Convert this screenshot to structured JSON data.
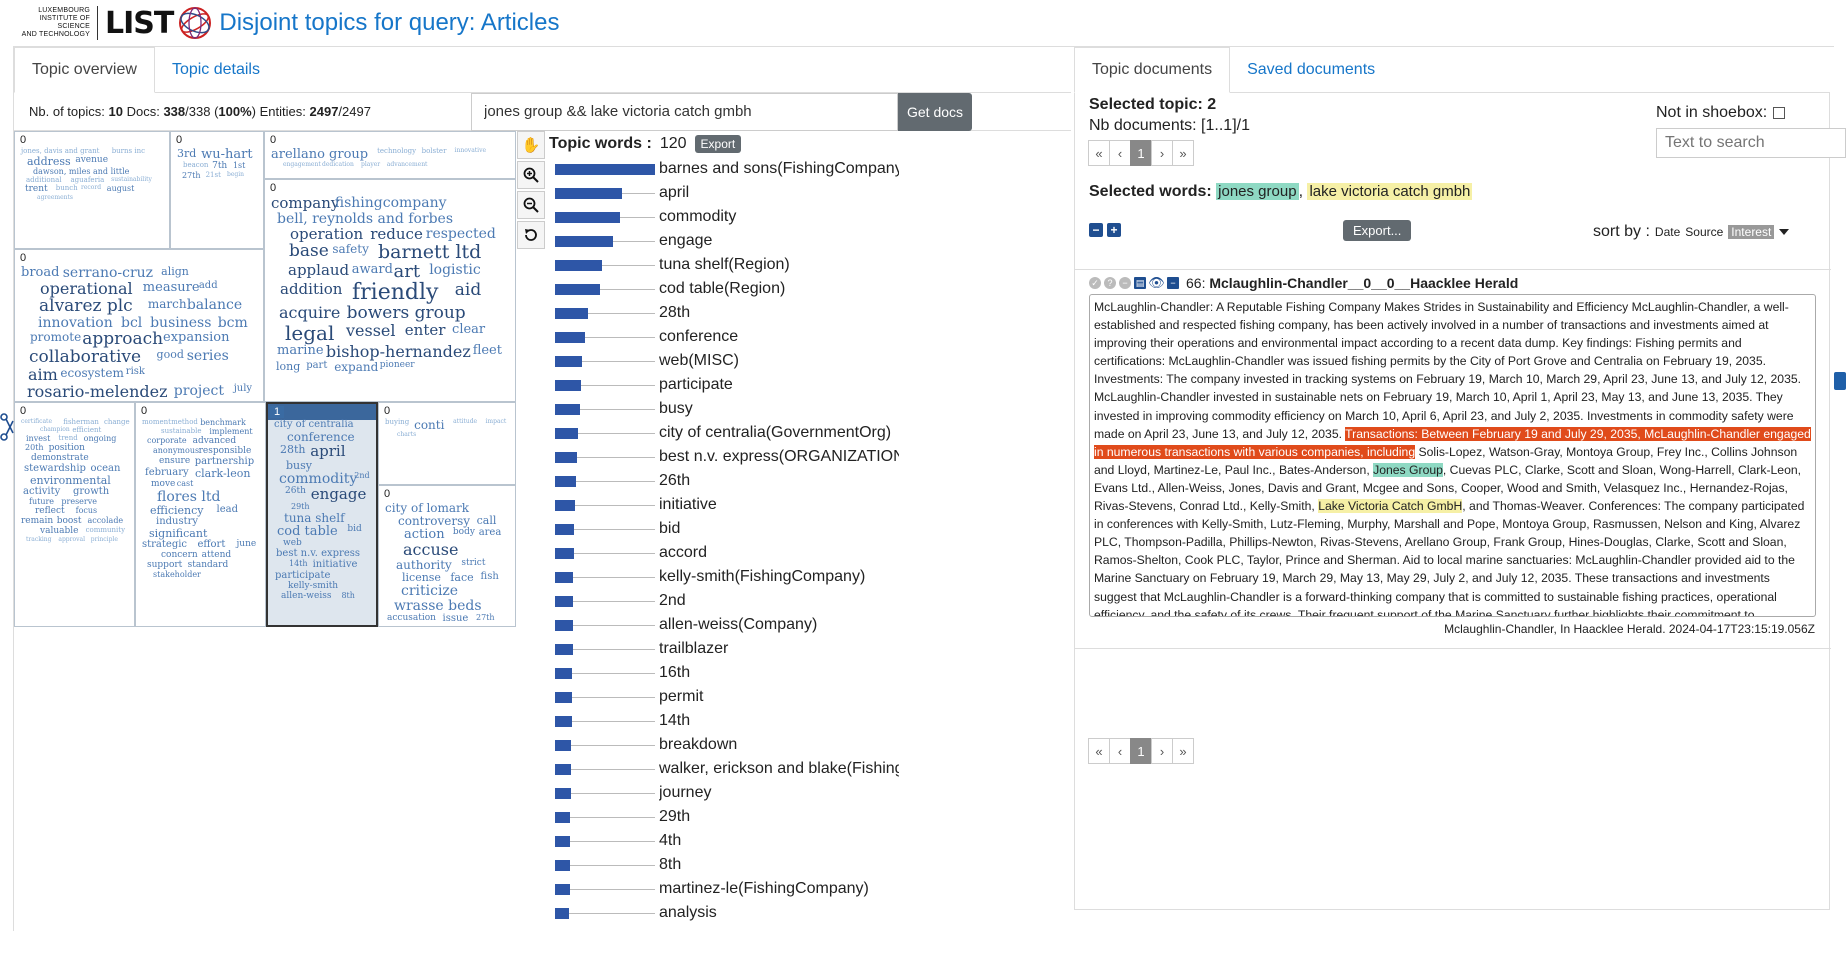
{
  "header": {
    "logo_lines": [
      "LUXEMBOURG",
      "INSTITUTE OF SCIENCE",
      "AND TECHNOLOGY"
    ],
    "logo_brand": "LIST",
    "title": "Disjoint topics for query: Articles"
  },
  "left_tabs": [
    {
      "label": "Topic overview",
      "active": true
    },
    {
      "label": "Topic details",
      "active": false
    }
  ],
  "right_tabs": [
    {
      "label": "Topic documents",
      "active": true
    },
    {
      "label": "Saved documents",
      "active": false
    }
  ],
  "info": {
    "topics_label": "Nb. of topics:",
    "topics": "10",
    "docs_label": "Docs:",
    "docs": "338",
    "docs_total": "/338 (",
    "docs_pct": "100%",
    "docs_close": ")",
    "entities_label": "Entities:",
    "entities": "2497",
    "entities_total": "/2497"
  },
  "query": {
    "value": "jones group && lake victoria catch gmbh",
    "button": "Get docs"
  },
  "topic_cells": [
    {
      "num": "0",
      "words": [
        "jones, davis and grant",
        "burns inc",
        "address",
        "avenue",
        "dawson, miles and little",
        "additional",
        "aguaferia",
        "sustainability",
        "trent",
        "bunch",
        "record",
        "august",
        "agreements"
      ]
    },
    {
      "num": "0",
      "words": [
        "3rd",
        "wu-hart",
        "beacon",
        "7th",
        "1st",
        "27th",
        "21st",
        "begin"
      ]
    },
    {
      "num": "0",
      "words": [
        "arellano group",
        "technology",
        "bolster",
        "innovative",
        "engagement",
        "dedication",
        "player",
        "advancement"
      ]
    },
    {
      "num": "0",
      "words": [
        "company",
        "fishingcompany",
        "bell, reynolds and forbes",
        "operation",
        "reduce",
        "respected",
        "base",
        "safety",
        "barnett ltd",
        "applaud",
        "award",
        "art",
        "logistic",
        "addition",
        "friendly",
        "aid",
        "acquire",
        "bowers group",
        "legal",
        "vessel",
        "enter",
        "clear",
        "marine",
        "bishop-hernandez",
        "fleet",
        "long",
        "part",
        "expand",
        "pioneer"
      ]
    },
    {
      "num": "0",
      "words": [
        "broad",
        "serrano-cruz",
        "align",
        "operational",
        "measure",
        "add",
        "alvarez plc",
        "march",
        "balance",
        "innovation",
        "bcl",
        "business",
        "bcm",
        "promote",
        "approach",
        "expansion",
        "collaborative",
        "good",
        "series",
        "aim",
        "ecosystem",
        "risk",
        "rosario-melendez",
        "project",
        "july",
        "success",
        "multiple"
      ]
    },
    {
      "num": "0",
      "words": [
        "certificate",
        "fisherman",
        "change",
        "champion",
        "efficient",
        "invest",
        "trend",
        "ongoing",
        "20th",
        "position",
        "demonstrate",
        "stewardship",
        "ocean",
        "environmental",
        "activity",
        "growth",
        "future",
        "preserve",
        "reflect",
        "focus",
        "remain",
        "boost",
        "accolade",
        "valuable",
        "community",
        "tracking",
        "approval",
        "principle"
      ]
    },
    {
      "num": "0",
      "words": [
        "moment",
        "method",
        "benchmark",
        "sustainable",
        "implement",
        "corporate",
        "advanced",
        "anonymous",
        "responsible",
        "ensure",
        "partnership",
        "february",
        "clark-leon",
        "move",
        "cast",
        "flores ltd",
        "efficiency",
        "lead",
        "industry",
        "significant",
        "strategic",
        "effort",
        "june",
        "concern",
        "attend",
        "support",
        "standard",
        "stakeholder"
      ]
    },
    {
      "num": "1",
      "selected": true,
      "words": [
        "city of centralia",
        "conference",
        "28th",
        "april",
        "busy",
        "commodity",
        "2nd",
        "26th",
        "engage",
        "29th",
        "tuna shelf",
        "cod table",
        "bid",
        "web",
        "best n.v. express",
        "14th",
        "initiative",
        "participate",
        "kelly-smith",
        "allen-weiss",
        "8th"
      ]
    },
    {
      "num": "0",
      "words": [
        "buying",
        "conti",
        "attitude",
        "impact",
        "charts"
      ]
    },
    {
      "num": "0",
      "words": [
        "city of lomark",
        "controversy",
        "call",
        "action",
        "body",
        "area",
        "accuse",
        "authority",
        "strict",
        "license",
        "face",
        "fish",
        "criticize",
        "wrasse beds",
        "accusation",
        "issue",
        "27th"
      ]
    }
  ],
  "map_tools": [
    {
      "name": "hand-icon",
      "glyph": "✋"
    },
    {
      "name": "zoom-in-icon",
      "glyph": "⊕"
    },
    {
      "name": "zoom-out-icon",
      "glyph": "⊖"
    },
    {
      "name": "reset-icon",
      "glyph": "↺"
    }
  ],
  "topic_words": {
    "title": "Topic words :",
    "count": "120",
    "export": "Export",
    "items": [
      {
        "label": "barnes and sons(FishingCompany)",
        "weight": 1.0
      },
      {
        "label": "april",
        "weight": 0.67
      },
      {
        "label": "commodity",
        "weight": 0.65
      },
      {
        "label": "engage",
        "weight": 0.58
      },
      {
        "label": "tuna shelf(Region)",
        "weight": 0.47
      },
      {
        "label": "cod table(Region)",
        "weight": 0.45
      },
      {
        "label": "28th",
        "weight": 0.33
      },
      {
        "label": "conference",
        "weight": 0.3
      },
      {
        "label": "web(MISC)",
        "weight": 0.27
      },
      {
        "label": "participate",
        "weight": 0.26
      },
      {
        "label": "busy",
        "weight": 0.25
      },
      {
        "label": "city of centralia(GovernmentOrg)",
        "weight": 0.23
      },
      {
        "label": "best n.v. express(ORGANIZATION)",
        "weight": 0.22
      },
      {
        "label": "26th",
        "weight": 0.21
      },
      {
        "label": "initiative",
        "weight": 0.2
      },
      {
        "label": "bid",
        "weight": 0.19
      },
      {
        "label": "accord",
        "weight": 0.19
      },
      {
        "label": "kelly-smith(FishingCompany)",
        "weight": 0.18
      },
      {
        "label": "2nd",
        "weight": 0.18
      },
      {
        "label": "allen-weiss(Company)",
        "weight": 0.18
      },
      {
        "label": "trailblazer",
        "weight": 0.18
      },
      {
        "label": "16th",
        "weight": 0.17
      },
      {
        "label": "permit",
        "weight": 0.17
      },
      {
        "label": "14th",
        "weight": 0.17
      },
      {
        "label": "breakdown",
        "weight": 0.16
      },
      {
        "label": "walker, erickson and blake(FishingCompany)",
        "weight": 0.16
      },
      {
        "label": "journey",
        "weight": 0.16
      },
      {
        "label": "29th",
        "weight": 0.15
      },
      {
        "label": "4th",
        "weight": 0.15
      },
      {
        "label": "8th",
        "weight": 0.15
      },
      {
        "label": "martinez-le(FishingCompany)",
        "weight": 0.15
      },
      {
        "label": "analysis",
        "weight": 0.14
      }
    ]
  },
  "right": {
    "selected_topic": "Selected topic: 2",
    "nb_docs": "Nb documents: [1..1]/1",
    "pager": [
      "«",
      "‹",
      "1",
      "›",
      "»"
    ],
    "shoebox_label": "Not in shoebox:",
    "search_placeholder": "Text to search",
    "selected_words_label": "Selected words:",
    "selected_word_1": "jones group",
    "selected_word_sep": ",",
    "selected_word_2": "lake victoria catch gmbh",
    "export_label": "Export...",
    "sort_label": "sort by :",
    "sort_options": [
      "Date",
      "Source",
      "Interest"
    ],
    "doc": {
      "id": "66:",
      "title": "Mclaughlin-Chandler__0__0__Haacklee Herald",
      "body_part1": "McLaughlin-Chandler: A Reputable Fishing Company Makes Strides in Sustainability and Efficiency McLaughlin-Chandler, a well-established and respected fishing company, has been actively involved in a number of transactions and investments aimed at improving their operations and environmental impact according to a recent data dump. Key findings: Fishing permits and certifications: McLaughlin-Chandler was issued fishing permits by the City of Port Grove and Centralia on February 19, 2035. Investments: The company invested in tracking systems on February 19, March 10, March 29, April 23, June 13, and July 12, 2035. McLaughlin-Chandler invested in sustainable nets on February 19, March 10, April 1, April 23, May 13, and June 13, 2035. They invested in improving commodity efficiency on March 10, April 6, April 23, and July 2, 2035. Investments in commodity safety were made on April 23, June 13, and July 12, 2035. ",
      "body_hl_red": "Transactions: Between February 19 and July 29, 2035, McLaughlin-Chandler engaged in numerous transactions with various companies, including",
      "body_part2": " Solis-Lopez, Watson-Gray, Montoya Group, Frey Inc., Collins Johnson and Lloyd, Martinez-Le, Paul Inc., Bates-Anderson, ",
      "body_hl_green": "Jones Group",
      "body_part3": ", Cuevas PLC, Clarke, Scott and Sloan, Wong-Harrell, Clark-Leon, Evans Ltd., Allen-Weiss, Jones, Davis and Grant, Mcgee and Sons, Cooper, Wood and Smith, Velasquez Inc., Hernandez-Rojas, Rivas-Stevens, Conrad Ltd., Kelly-Smith, ",
      "body_hl_yellow": "Lake Victoria Catch GmbH",
      "body_part4": ", and Thomas-Weaver. Conferences: The company participated in conferences with Kelly-Smith, Lutz-Fleming, Murphy, Marshall and Pope, Montoya Group, Rasmussen, Nelson and King, Alvarez PLC, Thompson-Padilla, Phillips-Newton, Rivas-Stevens, Arellano Group, Frank Group, Hines-Douglas, Clarke, Scott and Sloan, Ramos-Shelton, Cook PLC, Taylor, Prince and Sherman. Aid to local marine sanctuaries: McLaughlin-Chandler provided aid to the Marine Sanctuary on February 19, March 29, May 13, May 29, July 2, and July 12, 2035. These transactions and investments suggest that McLaughlin-Chandler is a forward-thinking company that is committed to sustainable fishing practices, operational efficiency, and the safety of its crews. Their frequent support of the Marine Sanctuary further highlights their commitment to environmental responsibility.",
      "meta": "Mclaughlin-Chandler, In Haacklee Herald. 2024-04-17T23:15:19.056Z"
    }
  },
  "colors": {
    "accent": "#1676c9",
    "bar": "#2e56a7",
    "button": "#626a70",
    "highlight_red": "#e04b1b",
    "highlight_green": "#8ed9c3",
    "highlight_yellow": "#f6f0a6"
  }
}
